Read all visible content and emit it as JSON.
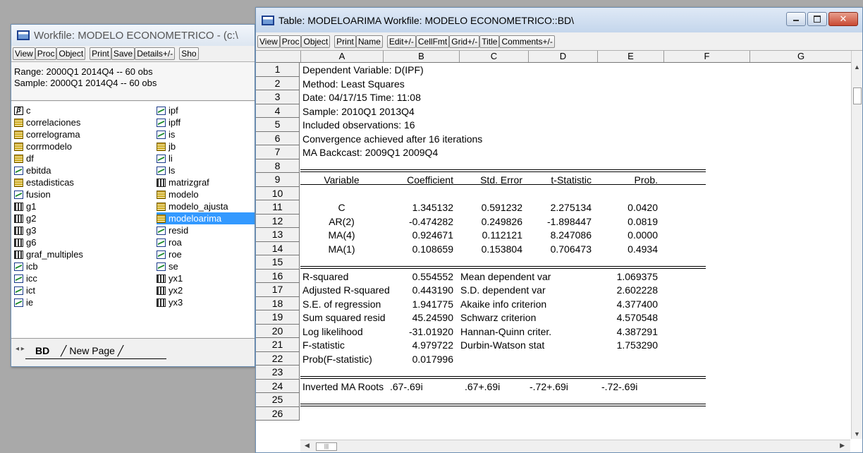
{
  "workfile_window": {
    "title": "Workfile: MODELO ECONOMETRICO - (c:\\",
    "toolbar": [
      "View",
      "Proc",
      "Object",
      "Print",
      "Save",
      "Details+/-",
      "Sho"
    ],
    "range_line": "Range:  2000Q1 2014Q4  --  60 obs",
    "sample_line": "Sample: 2000Q1 2014Q4  --  60 obs",
    "objects_col1": [
      {
        "name": "c",
        "icon": "coefficient-icon"
      },
      {
        "name": "correlaciones",
        "icon": "table-icon"
      },
      {
        "name": "correlograma",
        "icon": "table-icon"
      },
      {
        "name": "corrmodelo",
        "icon": "table-icon"
      },
      {
        "name": "df",
        "icon": "table-icon"
      },
      {
        "name": "ebitda",
        "icon": "series-icon"
      },
      {
        "name": "estadisticas",
        "icon": "table-icon"
      },
      {
        "name": "fusion",
        "icon": "series-icon"
      },
      {
        "name": "g1",
        "icon": "graph-icon"
      },
      {
        "name": "g2",
        "icon": "graph-icon"
      },
      {
        "name": "g3",
        "icon": "graph-icon"
      },
      {
        "name": "g6",
        "icon": "graph-icon"
      },
      {
        "name": "graf_multiples",
        "icon": "graph-icon"
      },
      {
        "name": "icb",
        "icon": "series-icon"
      },
      {
        "name": "icc",
        "icon": "series-icon"
      },
      {
        "name": "ict",
        "icon": "series-icon"
      },
      {
        "name": "ie",
        "icon": "series-icon"
      }
    ],
    "objects_col2": [
      {
        "name": "ipf",
        "icon": "series-icon"
      },
      {
        "name": "ipff",
        "icon": "series-icon"
      },
      {
        "name": "is",
        "icon": "series-icon"
      },
      {
        "name": "jb",
        "icon": "table-icon"
      },
      {
        "name": "li",
        "icon": "series-icon"
      },
      {
        "name": "ls",
        "icon": "series-icon"
      },
      {
        "name": "matrizgraf",
        "icon": "graph-icon"
      },
      {
        "name": "modelo",
        "icon": "table-icon"
      },
      {
        "name": "modelo_ajusta",
        "icon": "table-icon"
      },
      {
        "name": "modeloarima",
        "icon": "table-icon",
        "selected": true
      },
      {
        "name": "resid",
        "icon": "series-icon"
      },
      {
        "name": "roa",
        "icon": "series-icon"
      },
      {
        "name": "roe",
        "icon": "series-icon"
      },
      {
        "name": "se",
        "icon": "series-icon"
      },
      {
        "name": "yx1",
        "icon": "graph-icon"
      },
      {
        "name": "yx2",
        "icon": "graph-icon"
      },
      {
        "name": "yx3",
        "icon": "graph-icon"
      }
    ],
    "page_tabs": {
      "active": "BD",
      "new": "New Page"
    }
  },
  "table_window": {
    "title": "Table: MODELOARIMA   Workfile: MODELO ECONOMETRICO::BD\\",
    "toolbar": [
      "View",
      "Proc",
      "Object",
      "Print",
      "Name",
      "Edit+/-",
      "CellFmt",
      "Grid+/-",
      "Title",
      "Comments+/-"
    ],
    "columns": [
      "A",
      "B",
      "C",
      "D",
      "E",
      "F",
      "G"
    ],
    "row_numbers": [
      "1",
      "2",
      "3",
      "4",
      "5",
      "6",
      "7",
      "8",
      "9",
      "10",
      "11",
      "12",
      "13",
      "14",
      "15",
      "16",
      "17",
      "18",
      "19",
      "20",
      "21",
      "22",
      "23",
      "24",
      "25",
      "26"
    ],
    "header_lines": [
      "Dependent Variable: D(IPF)",
      "Method: Least Squares",
      "Date: 04/17/15   Time: 11:08",
      "Sample: 2010Q1 2013Q4",
      "Included observations: 16",
      "Convergence achieved after 16 iterations",
      "MA Backcast: 2009Q1 2009Q4"
    ],
    "coef_header": [
      "Variable",
      "Coefficient",
      "Std. Error",
      "t-Statistic",
      "Prob."
    ],
    "coef_rows": [
      [
        "C",
        "1.345132",
        "0.591232",
        "2.275134",
        "0.0420"
      ],
      [
        "AR(2)",
        "-0.474282",
        "0.249826",
        "-1.898447",
        "0.0819"
      ],
      [
        "MA(4)",
        "0.924671",
        "0.112121",
        "8.247086",
        "0.0000"
      ],
      [
        "MA(1)",
        "0.108659",
        "0.153804",
        "0.706473",
        "0.4934"
      ]
    ],
    "stats_rows": [
      [
        "R-squared",
        "0.554552",
        "Mean dependent var",
        "1.069375"
      ],
      [
        "Adjusted R-squared",
        "0.443190",
        "S.D. dependent var",
        "2.602228"
      ],
      [
        "S.E. of regression",
        "1.941775",
        "Akaike info criterion",
        "4.377400"
      ],
      [
        "Sum squared resid",
        "45.24590",
        "Schwarz criterion",
        "4.570548"
      ],
      [
        "Log likelihood",
        "-31.01920",
        "Hannan-Quinn criter.",
        "4.387291"
      ],
      [
        "F-statistic",
        "4.979722",
        "Durbin-Watson stat",
        "1.753290"
      ],
      [
        "Prob(F-statistic)",
        "0.017996",
        "",
        ""
      ]
    ],
    "roots_row": [
      "Inverted MA Roots",
      ".67-.69i",
      ".67+.69i",
      "-.72+.69i",
      "-.72-.69i"
    ]
  }
}
